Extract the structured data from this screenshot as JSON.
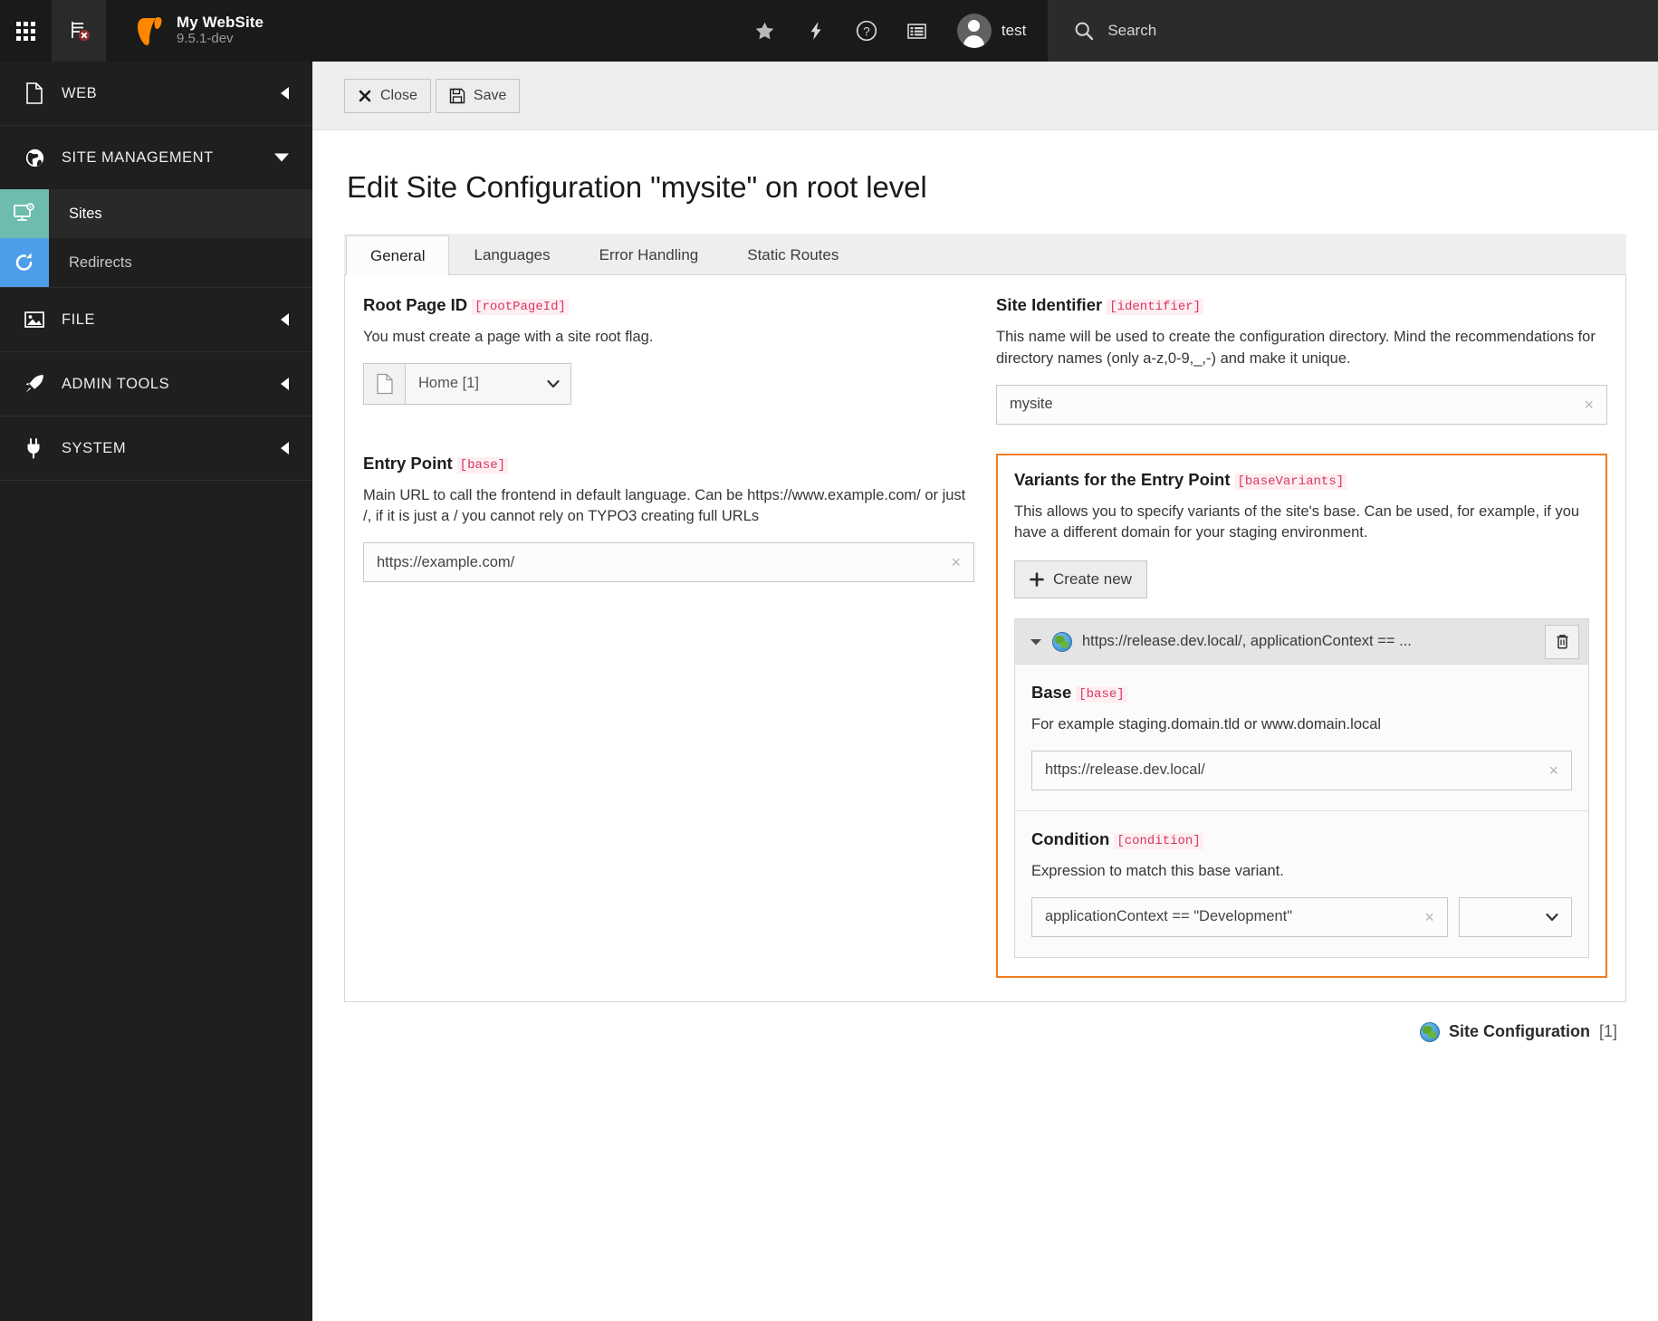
{
  "topbar": {
    "site_name": "My WebSite",
    "version": "9.5.1-dev",
    "username": "test",
    "search_label": "Search",
    "icons": [
      "module-menu-icon",
      "clear-cache-icon",
      "bookmark-star-icon",
      "flash-message-icon",
      "help-question-icon",
      "list-log-icon",
      "avatar",
      "search-icon"
    ]
  },
  "sidebar": {
    "groups": [
      {
        "label": "WEB",
        "icon": "page-document-icon",
        "caret": "left",
        "items": []
      },
      {
        "label": "SITE MANAGEMENT",
        "icon": "globe-icon",
        "caret": "down",
        "items": [
          {
            "label": "Sites",
            "icon": "site-config-icon",
            "selected": true,
            "color": "#6dbcae"
          },
          {
            "label": "Redirects",
            "icon": "redirect-refresh-icon",
            "selected": false,
            "color": "#4d9de8"
          }
        ]
      },
      {
        "label": "FILE",
        "icon": "image-file-icon",
        "caret": "left",
        "items": []
      },
      {
        "label": "ADMIN TOOLS",
        "icon": "rocket-icon",
        "caret": "left",
        "items": []
      },
      {
        "label": "SYSTEM",
        "icon": "plug-icon",
        "caret": "left",
        "items": []
      }
    ]
  },
  "docheader": {
    "close_label": "Close",
    "save_label": "Save"
  },
  "page": {
    "title": "Edit Site Configuration \"mysite\" on root level"
  },
  "tabs": [
    {
      "label": "General",
      "active": true
    },
    {
      "label": "Languages",
      "active": false
    },
    {
      "label": "Error Handling",
      "active": false
    },
    {
      "label": "Static Routes",
      "active": false
    }
  ],
  "fields": {
    "root_page_id": {
      "label": "Root Page ID",
      "key": "[rootPageId]",
      "description": "You must create a page with a site root flag.",
      "value": "Home [1]"
    },
    "site_identifier": {
      "label": "Site Identifier",
      "key": "[identifier]",
      "description": "This name will be used to create the configuration directory. Mind the recommendations for directory names (only a-z,0-9,_,-) and make it unique.",
      "value": "mysite",
      "clear": "×"
    },
    "entry_point": {
      "label": "Entry Point",
      "key": "[base]",
      "description": "Main URL to call the frontend in default language. Can be https://www.example.com/ or just /, if it is just a / you cannot rely on TYPO3 creating full URLs",
      "value": "https://example.com/",
      "clear": "×"
    },
    "base_variants": {
      "label": "Variants for the Entry Point",
      "key": "[baseVariants]",
      "description": "This allows you to specify variants of the site's base. Can be used, for example, if you have a different domain for your staging environment.",
      "create_new_label": "Create new",
      "variant": {
        "summary": "https://release.dev.local/, applicationContext == ...",
        "delete_title": "trash-icon",
        "base": {
          "label": "Base",
          "key": "[base]",
          "description": "For example staging.domain.tld or www.domain.local",
          "value": "https://release.dev.local/",
          "clear": "×"
        },
        "condition": {
          "label": "Condition",
          "key": "[condition]",
          "description": "Expression to match this base variant.",
          "value": "applicationContext == \"Development\"",
          "clear": "×",
          "select_value": ""
        }
      }
    }
  },
  "record_footer": {
    "name": "Site Configuration",
    "id": "[1]"
  },
  "colors": {
    "accent_orange": "#f07c1e",
    "key_pink": "#d9365e",
    "sites_tile": "#6dbcae",
    "redirects_tile": "#4d9de8",
    "topbar_bg": "#1a1a1a",
    "sidebar_bg": "#1f1f1f"
  }
}
